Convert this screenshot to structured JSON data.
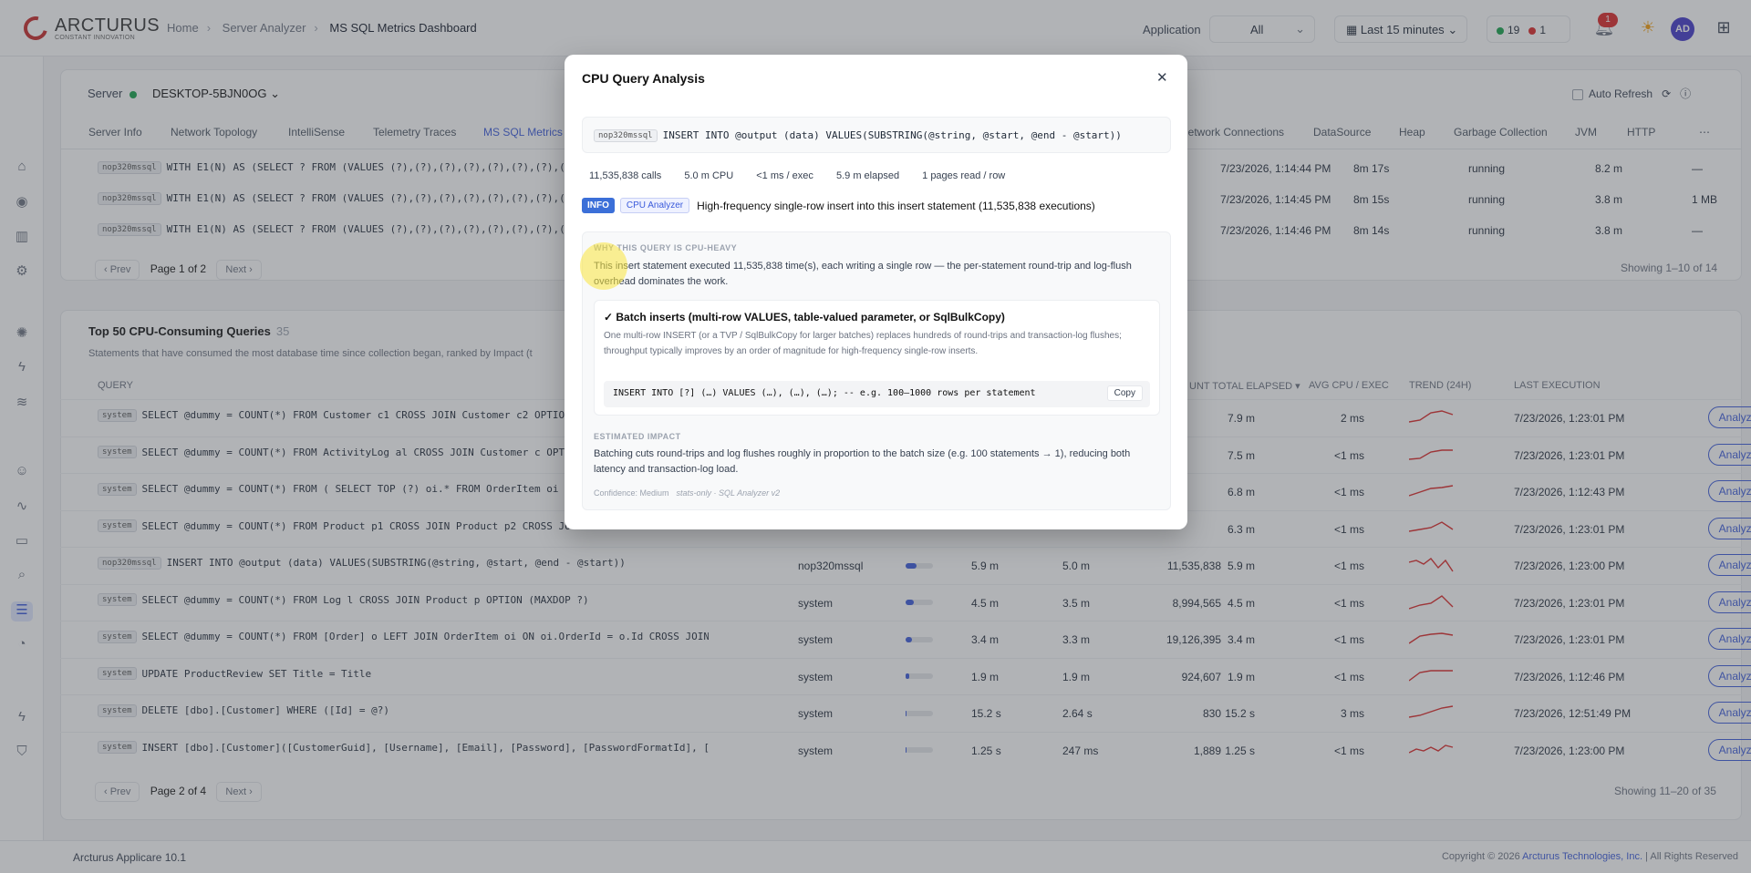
{
  "brand": {
    "name": "ARCTURUS",
    "tagline": "CONSTANT INNOVATION"
  },
  "breadcrumb": [
    "Home",
    "Server Analyzer",
    "MS SQL Metrics Dashboard"
  ],
  "header": {
    "application_label": "Application",
    "application_value": "All",
    "time_range": "Last 15 minutes",
    "status_green": "19",
    "status_red": "1",
    "notifications": "1",
    "avatar": "AD"
  },
  "server": {
    "label": "Server",
    "name": "DESKTOP-5BJN0OG",
    "auto_refresh": "Auto Refresh"
  },
  "tabs": [
    "Server Info",
    "Network Topology",
    "IntelliSense",
    "Telemetry Traces",
    "MS SQL Metrics",
    "Network Connections",
    "DataSource",
    "Heap",
    "Garbage Collection",
    "JVM",
    "HTTP"
  ],
  "upper_rows": [
    {
      "chip": "nop320mssql",
      "sql": "WITH E1(N) AS (SELECT ? FROM (VALUES (?),(?),(?),(?),(?),(?),(?),(?),(",
      "time": "7/23/2026, 1:14:44 PM",
      "dur": "8m 17s",
      "status": "running",
      "v1": "8.2 m",
      "v2": "—"
    },
    {
      "chip": "nop320mssql",
      "sql": "WITH E1(N) AS (SELECT ? FROM (VALUES (?),(?),(?),(?),(?),(?),(?),(?),(",
      "time": "7/23/2026, 1:14:45 PM",
      "dur": "8m 15s",
      "status": "running",
      "v1": "3.8 m",
      "v2": "1 MB"
    },
    {
      "chip": "nop320mssql",
      "sql": "WITH E1(N) AS (SELECT ? FROM (VALUES (?),(?),(?),(?),(?),(?),(?),(?),(",
      "time": "7/23/2026, 1:14:46 PM",
      "dur": "8m 14s",
      "status": "running",
      "v1": "3.8 m",
      "v2": "—"
    }
  ],
  "upper_pager": {
    "prev": "‹ Prev",
    "page": "Page 1 of 2",
    "next": "Next ›",
    "showing": "Showing 1–10 of 14"
  },
  "top50": {
    "title": "Top 50 CPU-Consuming Queries",
    "count": "35",
    "desc": "Statements that have consumed the most database time since collection began, ranked by Impact (t"
  },
  "table_headers": {
    "query": "QUERY",
    "total_elapsed": "UNT TOTAL ELAPSED ▾",
    "avg_cpu": "AVG CPU / EXEC",
    "trend": "TREND (24H)",
    "last": "LAST EXECUTION"
  },
  "rows": [
    {
      "chip": "system",
      "sql": "SELECT @dummy = COUNT(*) FROM Customer c1 CROSS JOIN Customer c2 OPTION",
      "db": "",
      "pct": 0,
      "cpu": "",
      "cpu2": "",
      "count": "",
      "elapsed": "7.9 m",
      "avg": "2 ms",
      "last": "7/23/2026, 1:23:01 PM",
      "action": "Analyze"
    },
    {
      "chip": "system",
      "sql": "SELECT @dummy = COUNT(*) FROM ActivityLog al CROSS JOIN Customer c OPTIO",
      "db": "",
      "pct": 0,
      "cpu": "",
      "cpu2": "",
      "count": "",
      "elapsed": "7.5 m",
      "avg": "<1 ms",
      "last": "7/23/2026, 1:23:01 PM",
      "action": "Analyze"
    },
    {
      "chip": "system",
      "sql": "SELECT @dummy = COUNT(*) FROM ( SELECT TOP (?) oi.* FROM OrderItem oi CR",
      "db": "",
      "pct": 0,
      "cpu": "",
      "cpu2": "",
      "count": "",
      "elapsed": "6.8 m",
      "avg": "<1 ms",
      "last": "7/23/2026, 1:12:43 PM",
      "action": "Analyze"
    },
    {
      "chip": "system",
      "sql": "SELECT @dummy = COUNT(*) FROM Product p1 CROSS JOIN Product p2 CROSS JOIN",
      "db": "",
      "pct": 0,
      "cpu": "",
      "cpu2": "",
      "count": "",
      "elapsed": "6.3 m",
      "avg": "<1 ms",
      "last": "7/23/2026, 1:23:01 PM",
      "action": "Analyze"
    },
    {
      "chip": "nop320mssql",
      "sql": "INSERT INTO @output (data) VALUES(SUBSTRING(@string, @start, @end - @start))",
      "db": "nop320mssql",
      "pct": 0.4,
      "cpu": "5.9 m",
      "cpu2": "5.0 m",
      "count": "11,535,838",
      "elapsed": "5.9 m",
      "avg": "<1 ms",
      "last": "7/23/2026, 1:23:00 PM",
      "action": "Analyze"
    },
    {
      "chip": "system",
      "sql": "SELECT @dummy = COUNT(*) FROM Log l CROSS JOIN Product p OPTION (MAXDOP ?)",
      "db": "system",
      "pct": 0.3,
      "cpu": "4.5 m",
      "cpu2": "3.5 m",
      "count": "8,994,565",
      "elapsed": "4.5 m",
      "avg": "<1 ms",
      "last": "7/23/2026, 1:23:01 PM",
      "action": "Analyze"
    },
    {
      "chip": "system",
      "sql": "SELECT @dummy = COUNT(*) FROM [Order] o LEFT JOIN OrderItem oi ON oi.OrderId = o.Id CROSS JOIN Customer c OP...",
      "db": "system",
      "pct": 0.22,
      "cpu": "3.4 m",
      "cpu2": "3.3 m",
      "count": "19,126,395",
      "elapsed": "3.4 m",
      "avg": "<1 ms",
      "last": "7/23/2026, 1:23:01 PM",
      "action": "Analyze"
    },
    {
      "chip": "system",
      "sql": "UPDATE ProductReview SET Title = Title",
      "db": "system",
      "pct": 0.12,
      "cpu": "1.9 m",
      "cpu2": "1.9 m",
      "count": "924,607",
      "elapsed": "1.9 m",
      "avg": "<1 ms",
      "last": "7/23/2026, 1:12:46 PM",
      "action": "Analyze"
    },
    {
      "chip": "system",
      "sql": "DELETE [dbo].[Customer] WHERE ([Id] = @?)",
      "db": "system",
      "pct": 0.04,
      "cpu": "15.2 s",
      "cpu2": "2.64 s",
      "count": "830",
      "elapsed": "15.2 s",
      "avg": "3 ms",
      "last": "7/23/2026, 12:51:49 PM",
      "action": "Analyze"
    },
    {
      "chip": "system",
      "sql": "INSERT [dbo].[Customer]([CustomerGuid], [Username], [Email], [Password], [PasswordFormatId], [PasswordSalt],...",
      "db": "system",
      "pct": 0.02,
      "cpu": "1.25 s",
      "cpu2": "247 ms",
      "count": "1,889",
      "elapsed": "1.25 s",
      "avg": "<1 ms",
      "last": "7/23/2026, 1:23:00 PM",
      "action": "Analyze"
    }
  ],
  "lower_pager": {
    "prev": "‹ Prev",
    "page": "Page 2 of 4",
    "next": "Next ›",
    "showing": "Showing 11–20 of 35"
  },
  "footer": {
    "version": "Arcturus Applicare 10.1",
    "copyright_pre": "Copyright © 2026",
    "company": "Arcturus Technologies, Inc.",
    "rights": "| All Rights Reserved"
  },
  "modal": {
    "title": "CPU Query Analysis",
    "close": "✕",
    "chip": "nop320mssql",
    "sql": "INSERT INTO @output (data) VALUES(SUBSTRING(@string, @start, @end - @start))",
    "stats": [
      "11,535,838 calls",
      "5.0 m CPU",
      "<1 ms / exec",
      "5.9 m elapsed",
      "1 pages read / row"
    ],
    "tag_info": "INFO",
    "tag_analyzer": "CPU Analyzer",
    "summary": "High-frequency single-row insert into this insert statement (11,535,838 executions)",
    "why_heading": "WHY THIS QUERY IS CPU-HEAVY",
    "why_body": "This insert statement executed 11,535,838 time(s), each writing a single row — the per-statement round-trip and log-flush overhead dominates the work.",
    "rec_title": "✓ Batch inserts (multi-row VALUES, table-valued parameter, or SqlBulkCopy)",
    "rec_desc": "One multi-row INSERT (or a TVP / SqlBulkCopy for larger batches) replaces hundreds of round-trips and transaction-log flushes; throughput typically improves by an order of magnitude for high-frequency single-row inserts.",
    "code": "INSERT INTO [?] (…) VALUES (…), (…), (…);  -- e.g. 100–1000 rows per statement",
    "copy": "Copy",
    "impact_heading": "ESTIMATED IMPACT",
    "impact_body": "Batching cuts round-trips and log flushes roughly in proportion to the batch size (e.g. 100 statements → 1), reducing both latency and transaction-log load.",
    "confidence": "Confidence: Medium",
    "source": "stats-only · SQL Analyzer v2"
  },
  "colors": {
    "accent": "#3b5bdb",
    "brand": "#c62828",
    "info": "#3b6fd8",
    "trend": "#dc2626"
  }
}
